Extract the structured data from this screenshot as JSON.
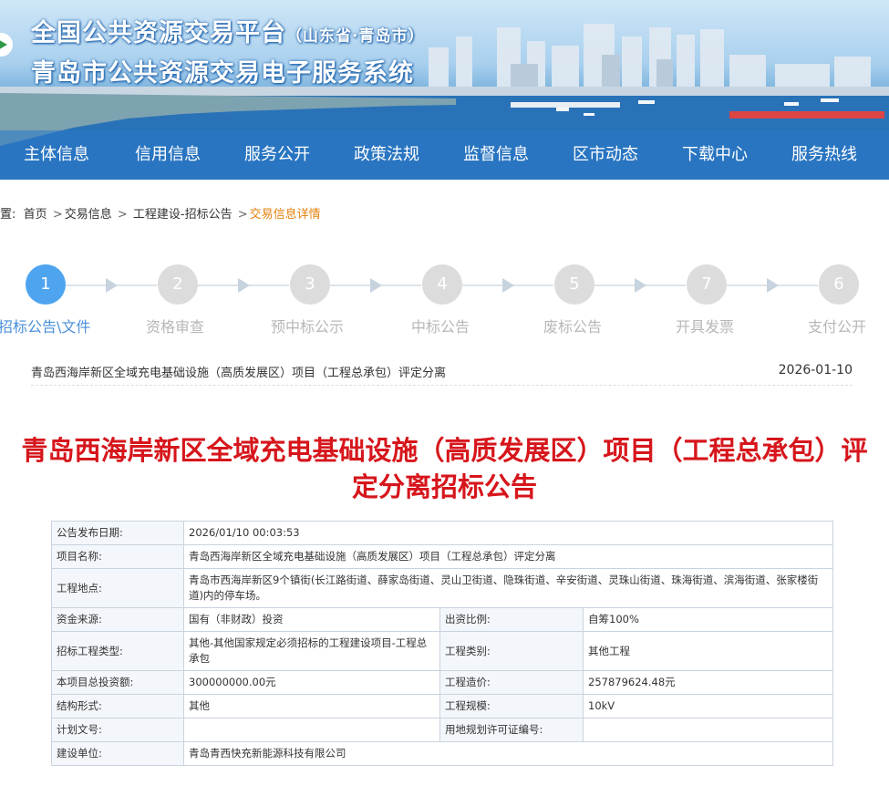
{
  "header": {
    "title_main": "全国公共资源交易平台",
    "title_region": "（山东省·青岛市）",
    "subtitle": "青岛市公共资源交易电子服务系统"
  },
  "nav": [
    "主体信息",
    "信用信息",
    "服务公开",
    "政策法规",
    "监督信息",
    "区市动态",
    "下载中心",
    "服务热线"
  ],
  "breadcrumb": {
    "prefix": "置:",
    "items": [
      "首页",
      "交易信息",
      "工程建设-招标公告"
    ],
    "current": "交易信息详情"
  },
  "steps": [
    {
      "num": "1",
      "label": "招标公告\\文件"
    },
    {
      "num": "2",
      "label": "资格审查"
    },
    {
      "num": "3",
      "label": "预中标公示"
    },
    {
      "num": "4",
      "label": "中标公告"
    },
    {
      "num": "5",
      "label": "废标公告"
    },
    {
      "num": "7",
      "label": "开具发票"
    },
    {
      "num": "6",
      "label": "支付公开"
    }
  ],
  "notice": {
    "title": "青岛西海岸新区全域充电基础设施（高质发展区）项目（工程总承包）评定分离",
    "date": "2026-01-10"
  },
  "main_title": "青岛西海岸新区全域充电基础设施（高质发展区）项目（工程总承包）评定分离招标公告",
  "table": {
    "publish_date_label": "公告发布日期:",
    "publish_date": "2026/01/10 00:03:53",
    "project_name_label": "项目名称:",
    "project_name": "青岛西海岸新区全域充电基础设施（高质发展区）项目（工程总承包）评定分离",
    "location_label": "工程地点:",
    "location": "青岛市西海岸新区9个镇街(长江路街道、薛家岛街道、灵山卫街道、隐珠街道、辛安街道、灵珠山街道、珠海街道、滨海街道、张家楼街道)内的停车场。",
    "fund_source_label": "资金来源:",
    "fund_source": "国有（非财政）投资",
    "fund_ratio_label": "出资比例:",
    "fund_ratio": "自筹100%",
    "project_type_label": "招标工程类型:",
    "project_type": "其他-其他国家规定必须招标的工程建设项目-工程总承包",
    "category_label": "工程类别:",
    "category": "其他工程",
    "total_investment_label": "本项目总投资额:",
    "total_investment": "300000000.00元",
    "cost_label": "工程造价:",
    "cost": "257879624.48元",
    "structure_label": "结构形式:",
    "structure": "其他",
    "scale_label": "工程规模:",
    "scale": "10kV",
    "plan_doc_label": "计划文号:",
    "plan_doc": "",
    "land_permit_label": "用地规划许可证编号:",
    "land_permit": "",
    "builder_label": "建设单位:",
    "builder": "青岛青西快充新能源科技有限公司"
  }
}
